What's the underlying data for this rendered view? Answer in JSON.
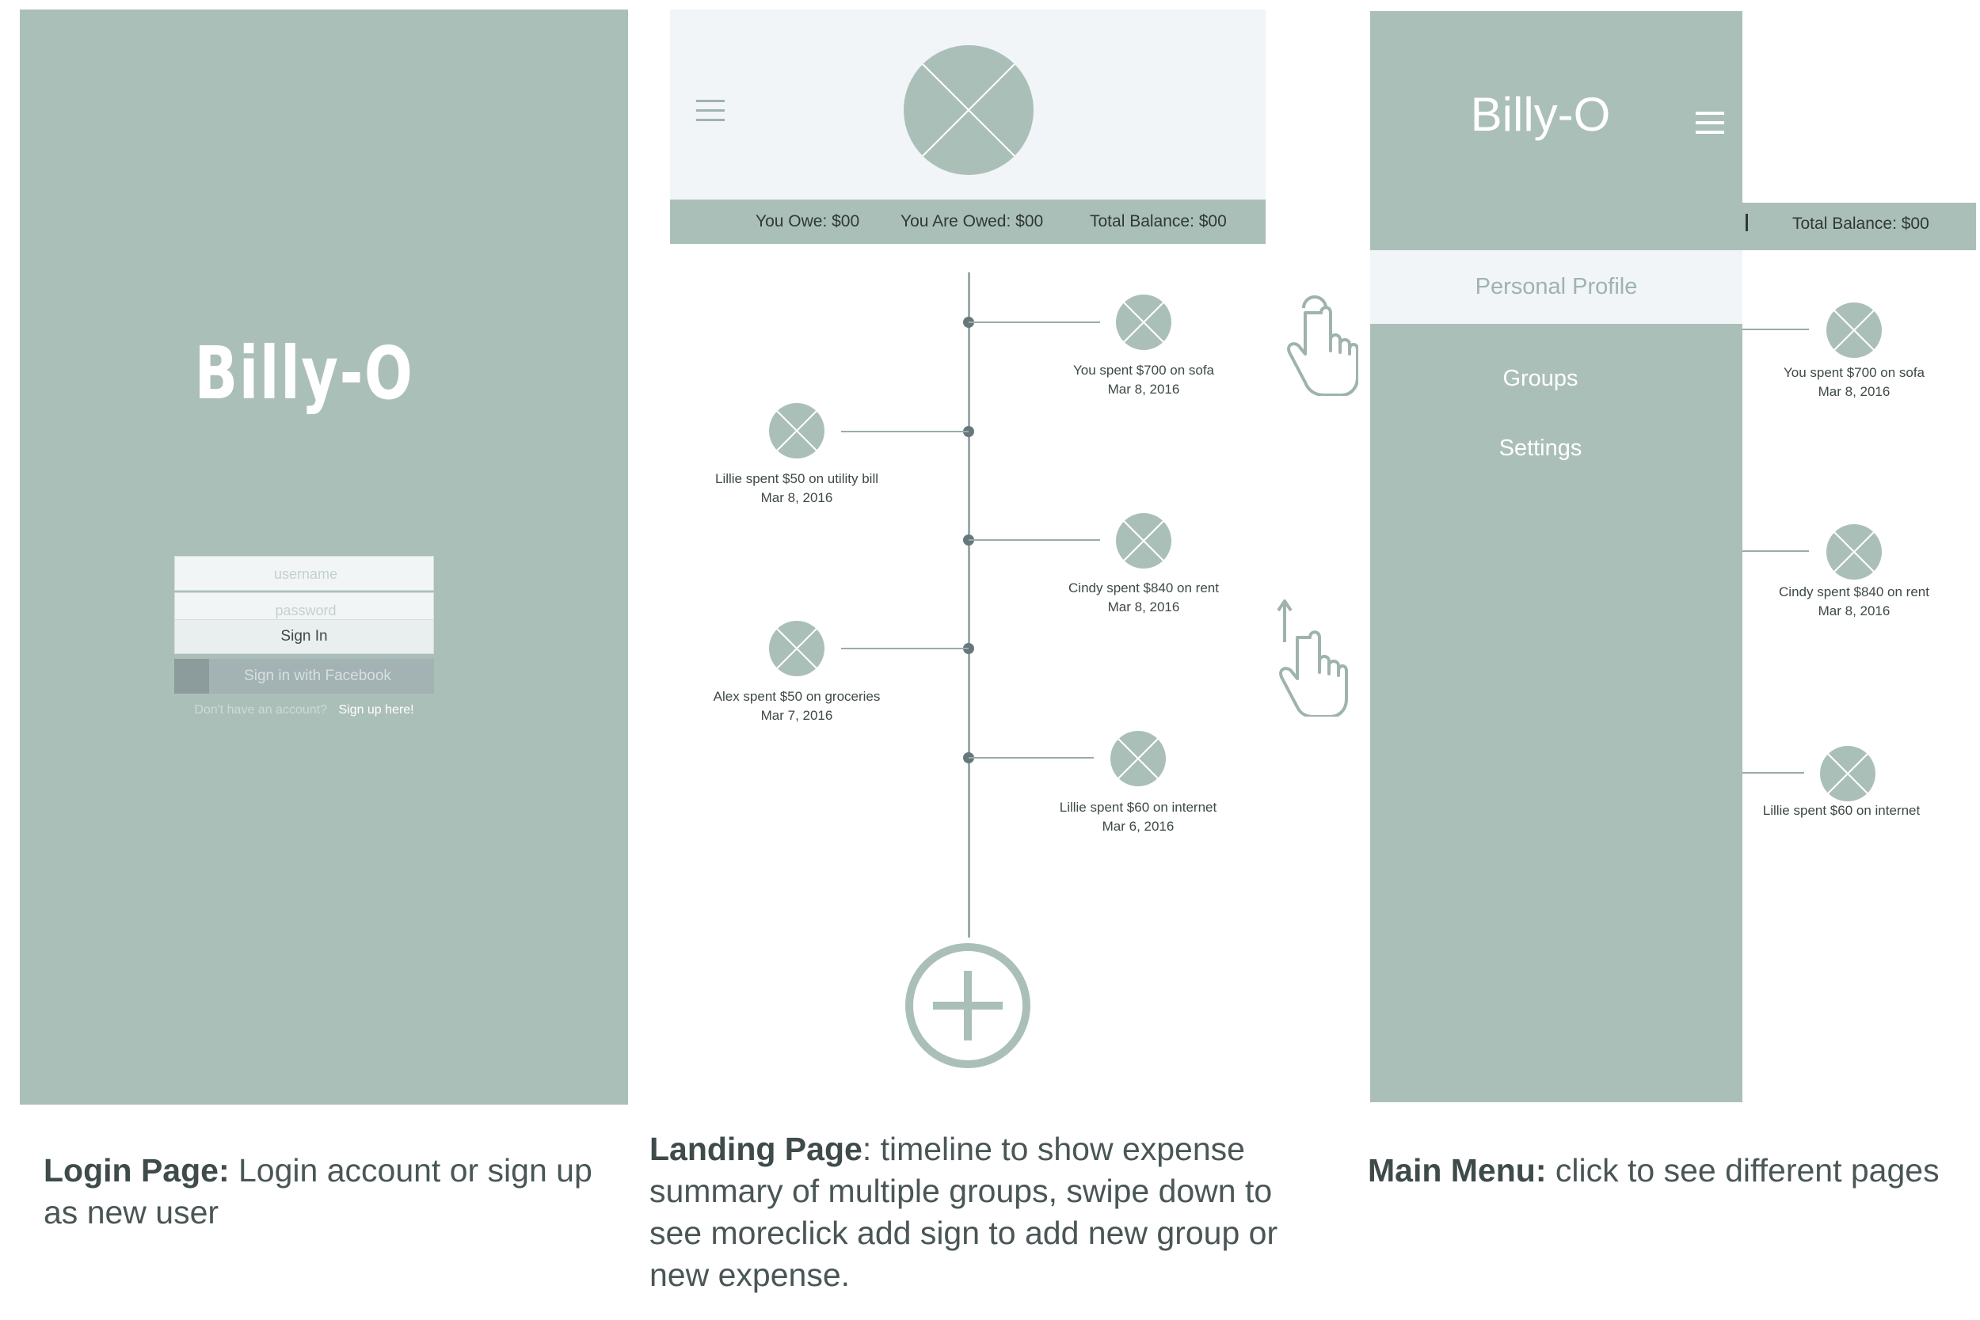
{
  "login": {
    "title": "Billy-O",
    "username_placeholder": "username",
    "password_placeholder": "password",
    "signin_label": "Sign In",
    "facebook_label": "Sign in with Facebook",
    "signup_question": "Don't have an account?",
    "signup_link": "Sign up here!"
  },
  "landing": {
    "summary": {
      "you_owe": "You Owe: $00",
      "you_are_owed": "You Are Owed: $00",
      "total_balance": "Total Balance: $00"
    },
    "timeline": [
      {
        "text": "You spent $700 on sofa",
        "date": "Mar 8, 2016",
        "side": "right"
      },
      {
        "text": "Lillie spent $50 on utility bill",
        "date": "Mar 8, 2016",
        "side": "left"
      },
      {
        "text": "Cindy spent $840 on rent",
        "date": "Mar 8, 2016",
        "side": "right"
      },
      {
        "text": "Alex spent $50 on groceries",
        "date": "Mar 7, 2016",
        "side": "left"
      },
      {
        "text": "Lillie spent $60 on internet",
        "date": "Mar 6, 2016",
        "side": "right"
      }
    ]
  },
  "menu": {
    "title": "Billy-O",
    "items": [
      "Personal Profile",
      "Groups",
      "Settings"
    ],
    "total_balance_partial": "Total Balance: $00",
    "timeline": [
      {
        "text": "You spent $700 on sofa",
        "date": "Mar 8, 2016"
      },
      {
        "text": "Cindy spent $840 on rent",
        "date": "Mar 8, 2016"
      },
      {
        "text": "Lillie spent $60 on internet",
        "date": ""
      }
    ]
  },
  "captions": {
    "login_title": "Login Page:",
    "login_body": " Login account or sign up as new user",
    "landing_title": "Landing Page",
    "landing_body": ": timeline to show expense summary of multiple groups, swipe down to see moreclick add sign to add new group or new expense.",
    "menu_title": "Main Menu:",
    "menu_body": " click to see different pages"
  },
  "colors": {
    "sage": "#abbfb9",
    "light": "#f1f5f7",
    "text": "#4e5a59"
  },
  "icons": [
    "hamburger-icon",
    "placeholder-image-icon",
    "add-icon",
    "tap-gesture-icon",
    "swipe-gesture-icon"
  ]
}
